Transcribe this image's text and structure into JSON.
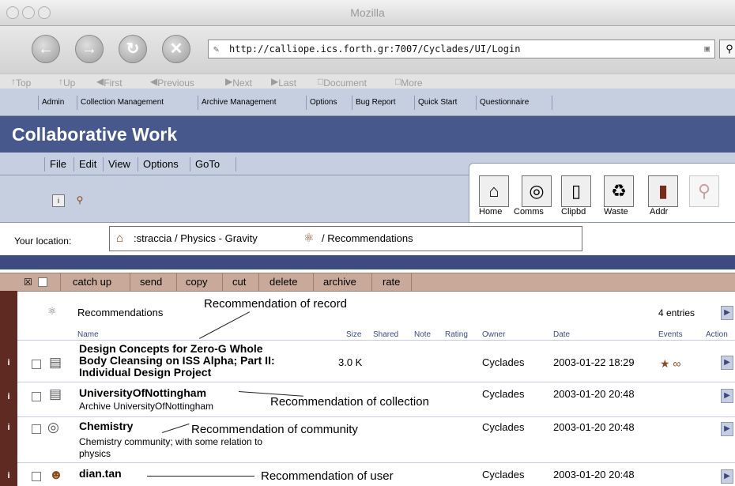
{
  "window": {
    "title": "Mozilla"
  },
  "browser": {
    "url": "http://calliope.ics.forth.gr:7007/Cyclades/UI/Login",
    "subnav": [
      "Top",
      "Up",
      "First",
      "Previous",
      "Next",
      "Last",
      "Document",
      "More"
    ]
  },
  "app_menu": [
    "Admin",
    "Collection Management",
    "Archive Management",
    "Options",
    "Bug Report",
    "Quick Start",
    "Questionnaire"
  ],
  "header": {
    "title": "Collaborative Work"
  },
  "menus": [
    "File",
    "Edit",
    "View",
    "Options",
    "GoTo"
  ],
  "tools": [
    {
      "label": "Home",
      "icon": "home-icon"
    },
    {
      "label": "Comms",
      "icon": "globe-icon"
    },
    {
      "label": "Clipbd",
      "icon": "clipboard-icon"
    },
    {
      "label": "Waste",
      "icon": "trash-icon"
    },
    {
      "label": "Addr",
      "icon": "address-book-icon"
    }
  ],
  "location": {
    "label": "Your location:",
    "path_part1": ":straccia / Physics - Gravity",
    "path_part2": "/ Recommendations"
  },
  "actions": [
    "catch up",
    "send",
    "copy",
    "cut",
    "delete",
    "archive",
    "rate"
  ],
  "folder": {
    "name": "Recommendations",
    "entries": "4 entries"
  },
  "columns": [
    "Name",
    "Size",
    "Shared",
    "Note",
    "Rating",
    "Owner",
    "Date",
    "Events",
    "Action"
  ],
  "rows": [
    {
      "title_l1": "Design Concepts for Zero-G Whole",
      "title_l2": "Body Cleansing on ISS Alpha; Part II:",
      "title_l3": "Individual Design Project",
      "size": "3.0 K",
      "owner": "Cyclades",
      "date": "2003-01-22 18:29"
    },
    {
      "title": "UniversityOfNottingham",
      "subtitle": "Archive UniversityOfNottingham",
      "owner": "Cyclades",
      "date": "2003-01-20 20:48"
    },
    {
      "title": "Chemistry",
      "subtitle_l1": "Chemistry community; with some relation to",
      "subtitle_l2": "physics",
      "owner": "Cyclades",
      "date": "2003-01-20 20:48"
    },
    {
      "title": "dian.tan",
      "owner": "Cyclades",
      "date": "2003-01-20 20:48"
    }
  ],
  "annotations": {
    "record": "Recommendation of record",
    "collection": "Recommendation of collection",
    "community": "Recommendation of community",
    "user": "Recommendation of user"
  },
  "colors": {
    "header_bg": "#47588c",
    "menu_bg": "#c6cfe0",
    "action_bg": "#c8a99a",
    "left_strip": "#5e2a22"
  }
}
